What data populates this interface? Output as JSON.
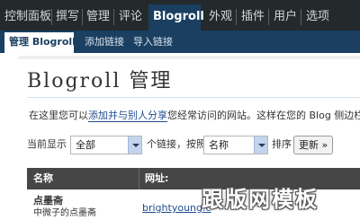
{
  "top_menu": {
    "items": [
      "控制面板",
      "撰写",
      "管理",
      "评论",
      "外观",
      "插件",
      "用户",
      "选项"
    ],
    "active": "Blogroll"
  },
  "sub_menu": {
    "active": "管理 Blogroll",
    "items": [
      "添加链接",
      "导入链接"
    ]
  },
  "page": {
    "title": "Blogroll 管理",
    "intro_before": "在这里您可以",
    "intro_link": "添加并与别人分享",
    "intro_after": "您经常访问的网站。这样在您的 Blog 侧边栏"
  },
  "filter": {
    "show_label": "当前显示",
    "category_value": "全部",
    "links_label": "个链接，按照",
    "order_value": "名称",
    "sort_label": "排序",
    "update_button": "更新 »"
  },
  "table": {
    "headers": [
      "名称",
      "网址:"
    ],
    "rows": [
      {
        "name": "点墨斋",
        "description": "中微子的点墨斋",
        "url": "brightyoung.c"
      }
    ]
  },
  "watermark": "跟版网模板",
  "colors": {
    "top_bg": "#24292c",
    "accent": "#1a3f61",
    "link": "#1f4c8f",
    "table_header": "#464646"
  }
}
